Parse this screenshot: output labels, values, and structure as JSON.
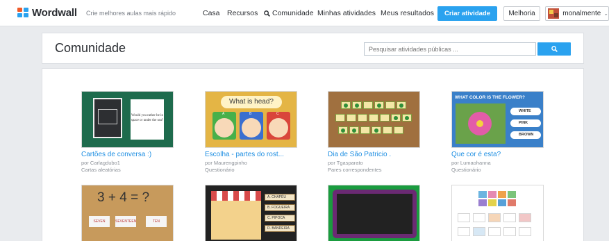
{
  "header": {
    "logo_text": "Wordwall",
    "tagline": "Crie melhores aulas mais rápido",
    "nav": {
      "casa": "Casa",
      "recursos": "Recursos",
      "comunidade": "Comunidade",
      "minhas": "Minhas atividades",
      "resultados": "Meus resultados"
    },
    "create_button": "Criar atividade",
    "upgrade_button": "Melhoria",
    "username": "monalmente",
    "user_chevron": "⌄"
  },
  "page": {
    "title": "Comunidade",
    "search_placeholder": "Pesquisar atividades públicas ..."
  },
  "activities": [
    {
      "title": "Cartões de conversa :)",
      "author": "por Carlagdubo1",
      "type": "Cartas aleatórias",
      "thumb_text": "Would you rather be in space or under the sea?"
    },
    {
      "title": "Escolha - partes do rost...",
      "author": "por Maurengpinho",
      "type": "Questionário",
      "thumb_text": "What is head?",
      "options": [
        "A",
        "B",
        "C"
      ]
    },
    {
      "title": "Dia de São Patricio .",
      "author": "por Tgasparato",
      "type": "Pares correspondentes"
    },
    {
      "title": "Que cor é esta?",
      "author": "por Lumaohanna",
      "type": "Questionário",
      "thumb_text": "WHAT COLOR IS THE FLOWER?",
      "options": [
        "WHITE",
        "PINK",
        "BROWN"
      ]
    },
    {
      "thumb_text": "3 + 4 = ?",
      "options": [
        "SEVEN",
        "SEVENTEEN",
        "TEN"
      ]
    },
    {
      "options": [
        "A. CHAPÉU",
        "B. FOGUEIRA",
        "C. PIPOCA",
        "D. BANDEIRA"
      ]
    },
    {},
    {}
  ]
}
